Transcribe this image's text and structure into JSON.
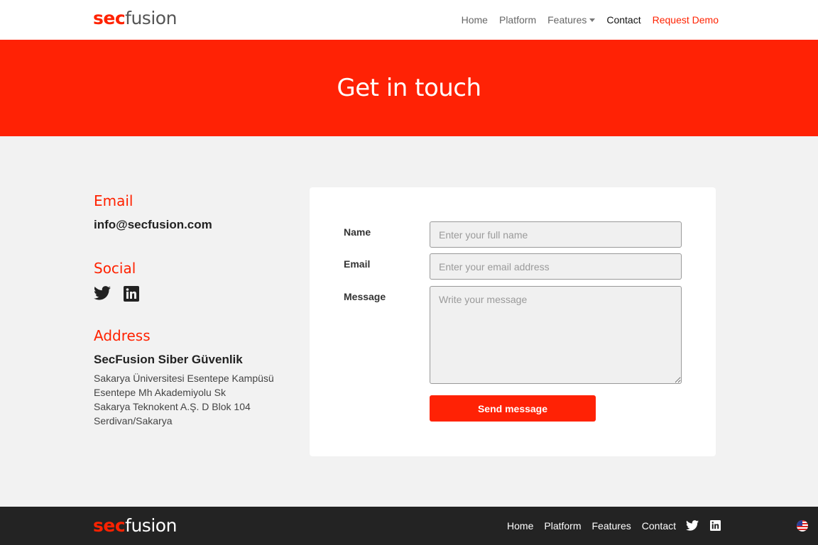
{
  "brand": {
    "logo_sec": "sec",
    "logo_fusion": "fusion",
    "accent_color": "#ff2205"
  },
  "nav": {
    "home": "Home",
    "platform": "Platform",
    "features": "Features",
    "contact": "Contact",
    "request_demo": "Request Demo"
  },
  "hero": {
    "title": "Get in touch"
  },
  "contact_info": {
    "email_heading": "Email",
    "email_value": "info@secfusion.com",
    "social_heading": "Social",
    "social_icons": [
      "twitter-icon",
      "linkedin-icon"
    ],
    "address_heading": "Address",
    "company_name": "SecFusion Siber Güvenlik",
    "address_lines": [
      "Sakarya Üniversitesi Esentepe Kampüsü",
      "Esentepe Mh Akademiyolu Sk",
      "Sakarya Teknokent A.Ş. D Blok 104",
      "Serdivan/Sakarya"
    ]
  },
  "form": {
    "name_label": "Name",
    "name_placeholder": "Enter your full name",
    "name_value": "",
    "email_label": "Email",
    "email_placeholder": "Enter your email address",
    "email_value": "",
    "message_label": "Message",
    "message_placeholder": "Write your message",
    "message_value": "",
    "submit_label": "Send message"
  },
  "footer": {
    "logo_sec": "sec",
    "logo_fusion": "fusion",
    "nav": {
      "home": "Home",
      "platform": "Platform",
      "features": "Features",
      "contact": "Contact"
    },
    "icons": [
      "twitter-icon",
      "linkedin-icon"
    ],
    "language_icon": "us-flag-icon"
  }
}
